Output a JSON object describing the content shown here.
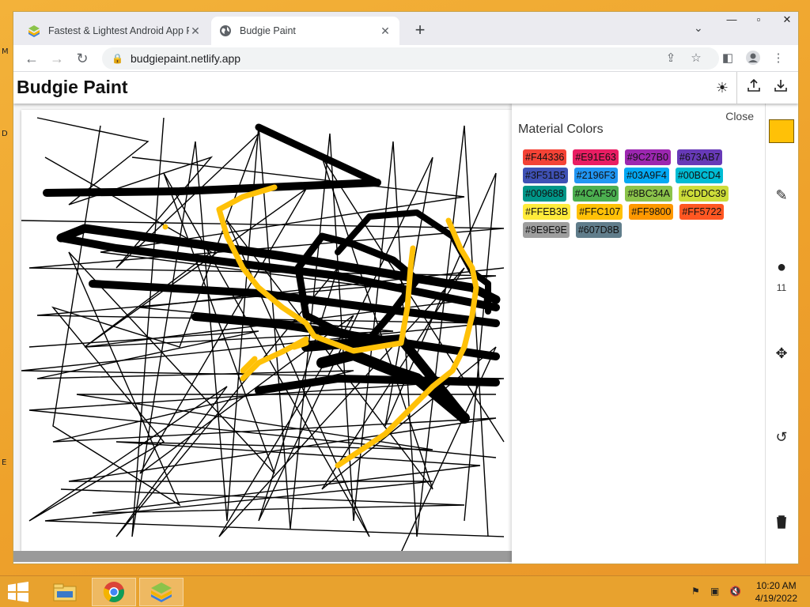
{
  "desktop": {
    "letters": [
      "M",
      "D",
      "E"
    ]
  },
  "browser": {
    "tabs": [
      {
        "title": "Fastest & Lightest Android App P",
        "active": false,
        "icon": "bluestacks-icon"
      },
      {
        "title": "Budgie Paint",
        "active": true,
        "icon": "globe-icon"
      }
    ],
    "url": "budgiepaint.netlify.app"
  },
  "app": {
    "title": "Budgie Paint",
    "panel": {
      "title": "Material Colors",
      "close_label": "Close",
      "colors": [
        "#F44336",
        "#E91E63",
        "#9C27B0",
        "#673AB7",
        "#3F51B5",
        "#2196F3",
        "#03A9F4",
        "#00BCD4",
        "#009688",
        "#4CAF50",
        "#8BC34A",
        "#CDDC39",
        "#FFEB3B",
        "#FFC107",
        "#FF9800",
        "#FF5722",
        "#9E9E9E",
        "#607D8B"
      ]
    },
    "toolbar": {
      "current_color": "#FFC107",
      "brush_size": "11"
    }
  },
  "taskbar": {
    "time": "10:20 AM",
    "date": "4/19/2022"
  }
}
